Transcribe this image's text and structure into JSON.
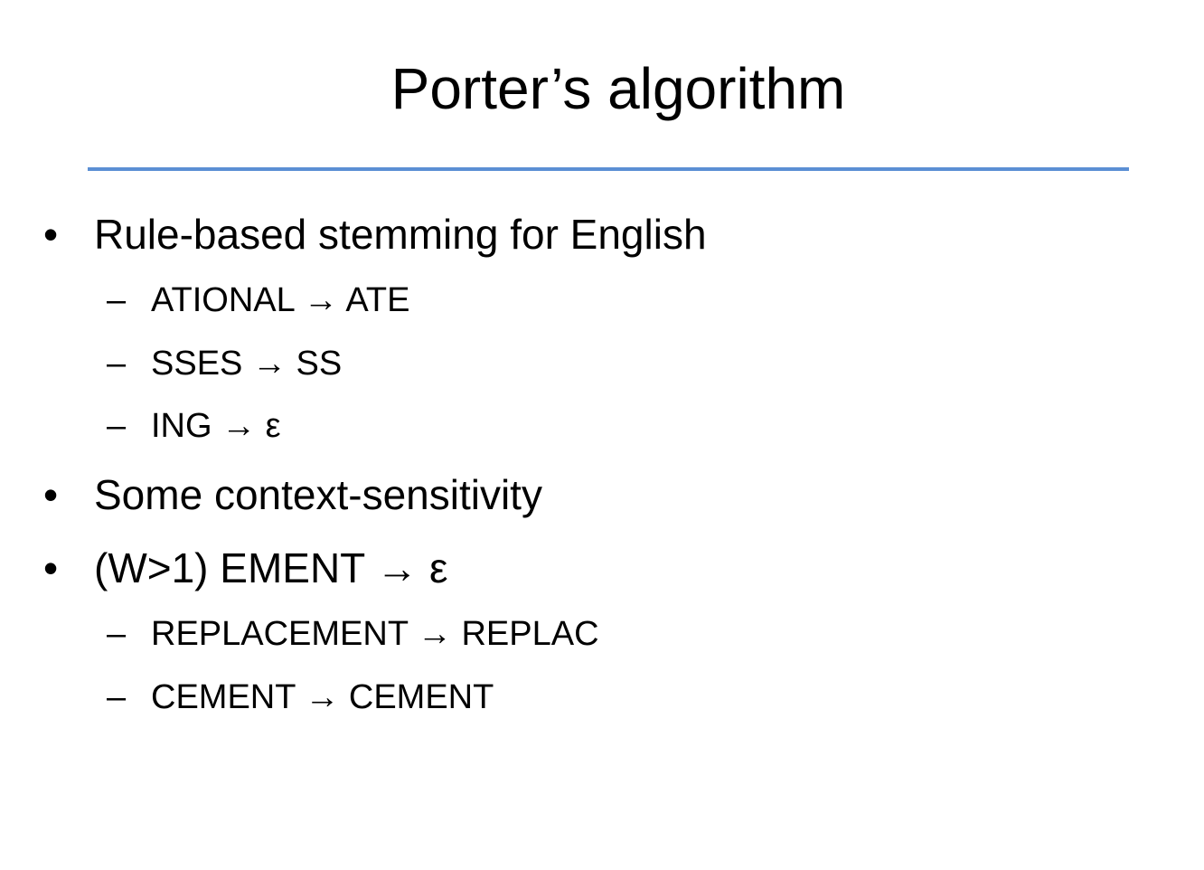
{
  "slide": {
    "title": "Porter’s algorithm",
    "accent_rule_color": "#5b8fd4",
    "bullet_glyph": "•",
    "sub_glyph": "–"
  },
  "items": [
    {
      "text": "Rule-based stemming for English",
      "sub": [
        "ATIONAL → ATE",
        "SSES → SS",
        "ING → ε"
      ]
    },
    {
      "text": "Some context-sensitivity",
      "sub": []
    },
    {
      "text": "(W>1) EMENT → ε",
      "sub": [
        "REPLACEMENT → REPLAC",
        "CEMENT → CEMENT"
      ]
    }
  ]
}
